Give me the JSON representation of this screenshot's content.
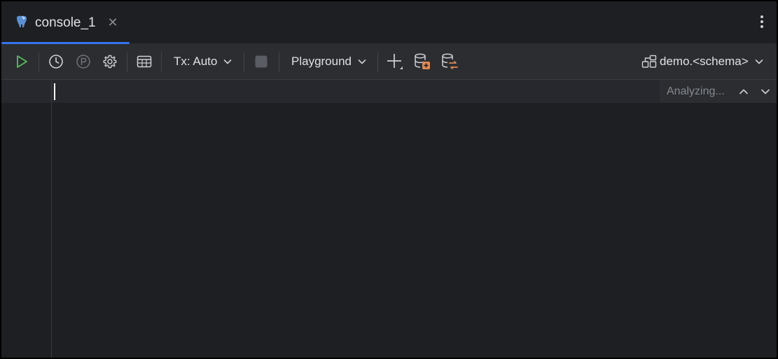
{
  "tab": {
    "label": "console_1",
    "icon": "postgresql-elephant-icon",
    "close": "✕"
  },
  "toolbar": {
    "tx_label": "Tx: Auto",
    "playground_label": "Playground",
    "schema_label": "demo.<schema>"
  },
  "editor": {
    "analyzing_text": "Analyzing..."
  },
  "colors": {
    "accent": "#3574f0",
    "run": "#5fb865",
    "orange": "#e08855",
    "background": "#1e1f22",
    "toolbar": "#2b2d30"
  }
}
